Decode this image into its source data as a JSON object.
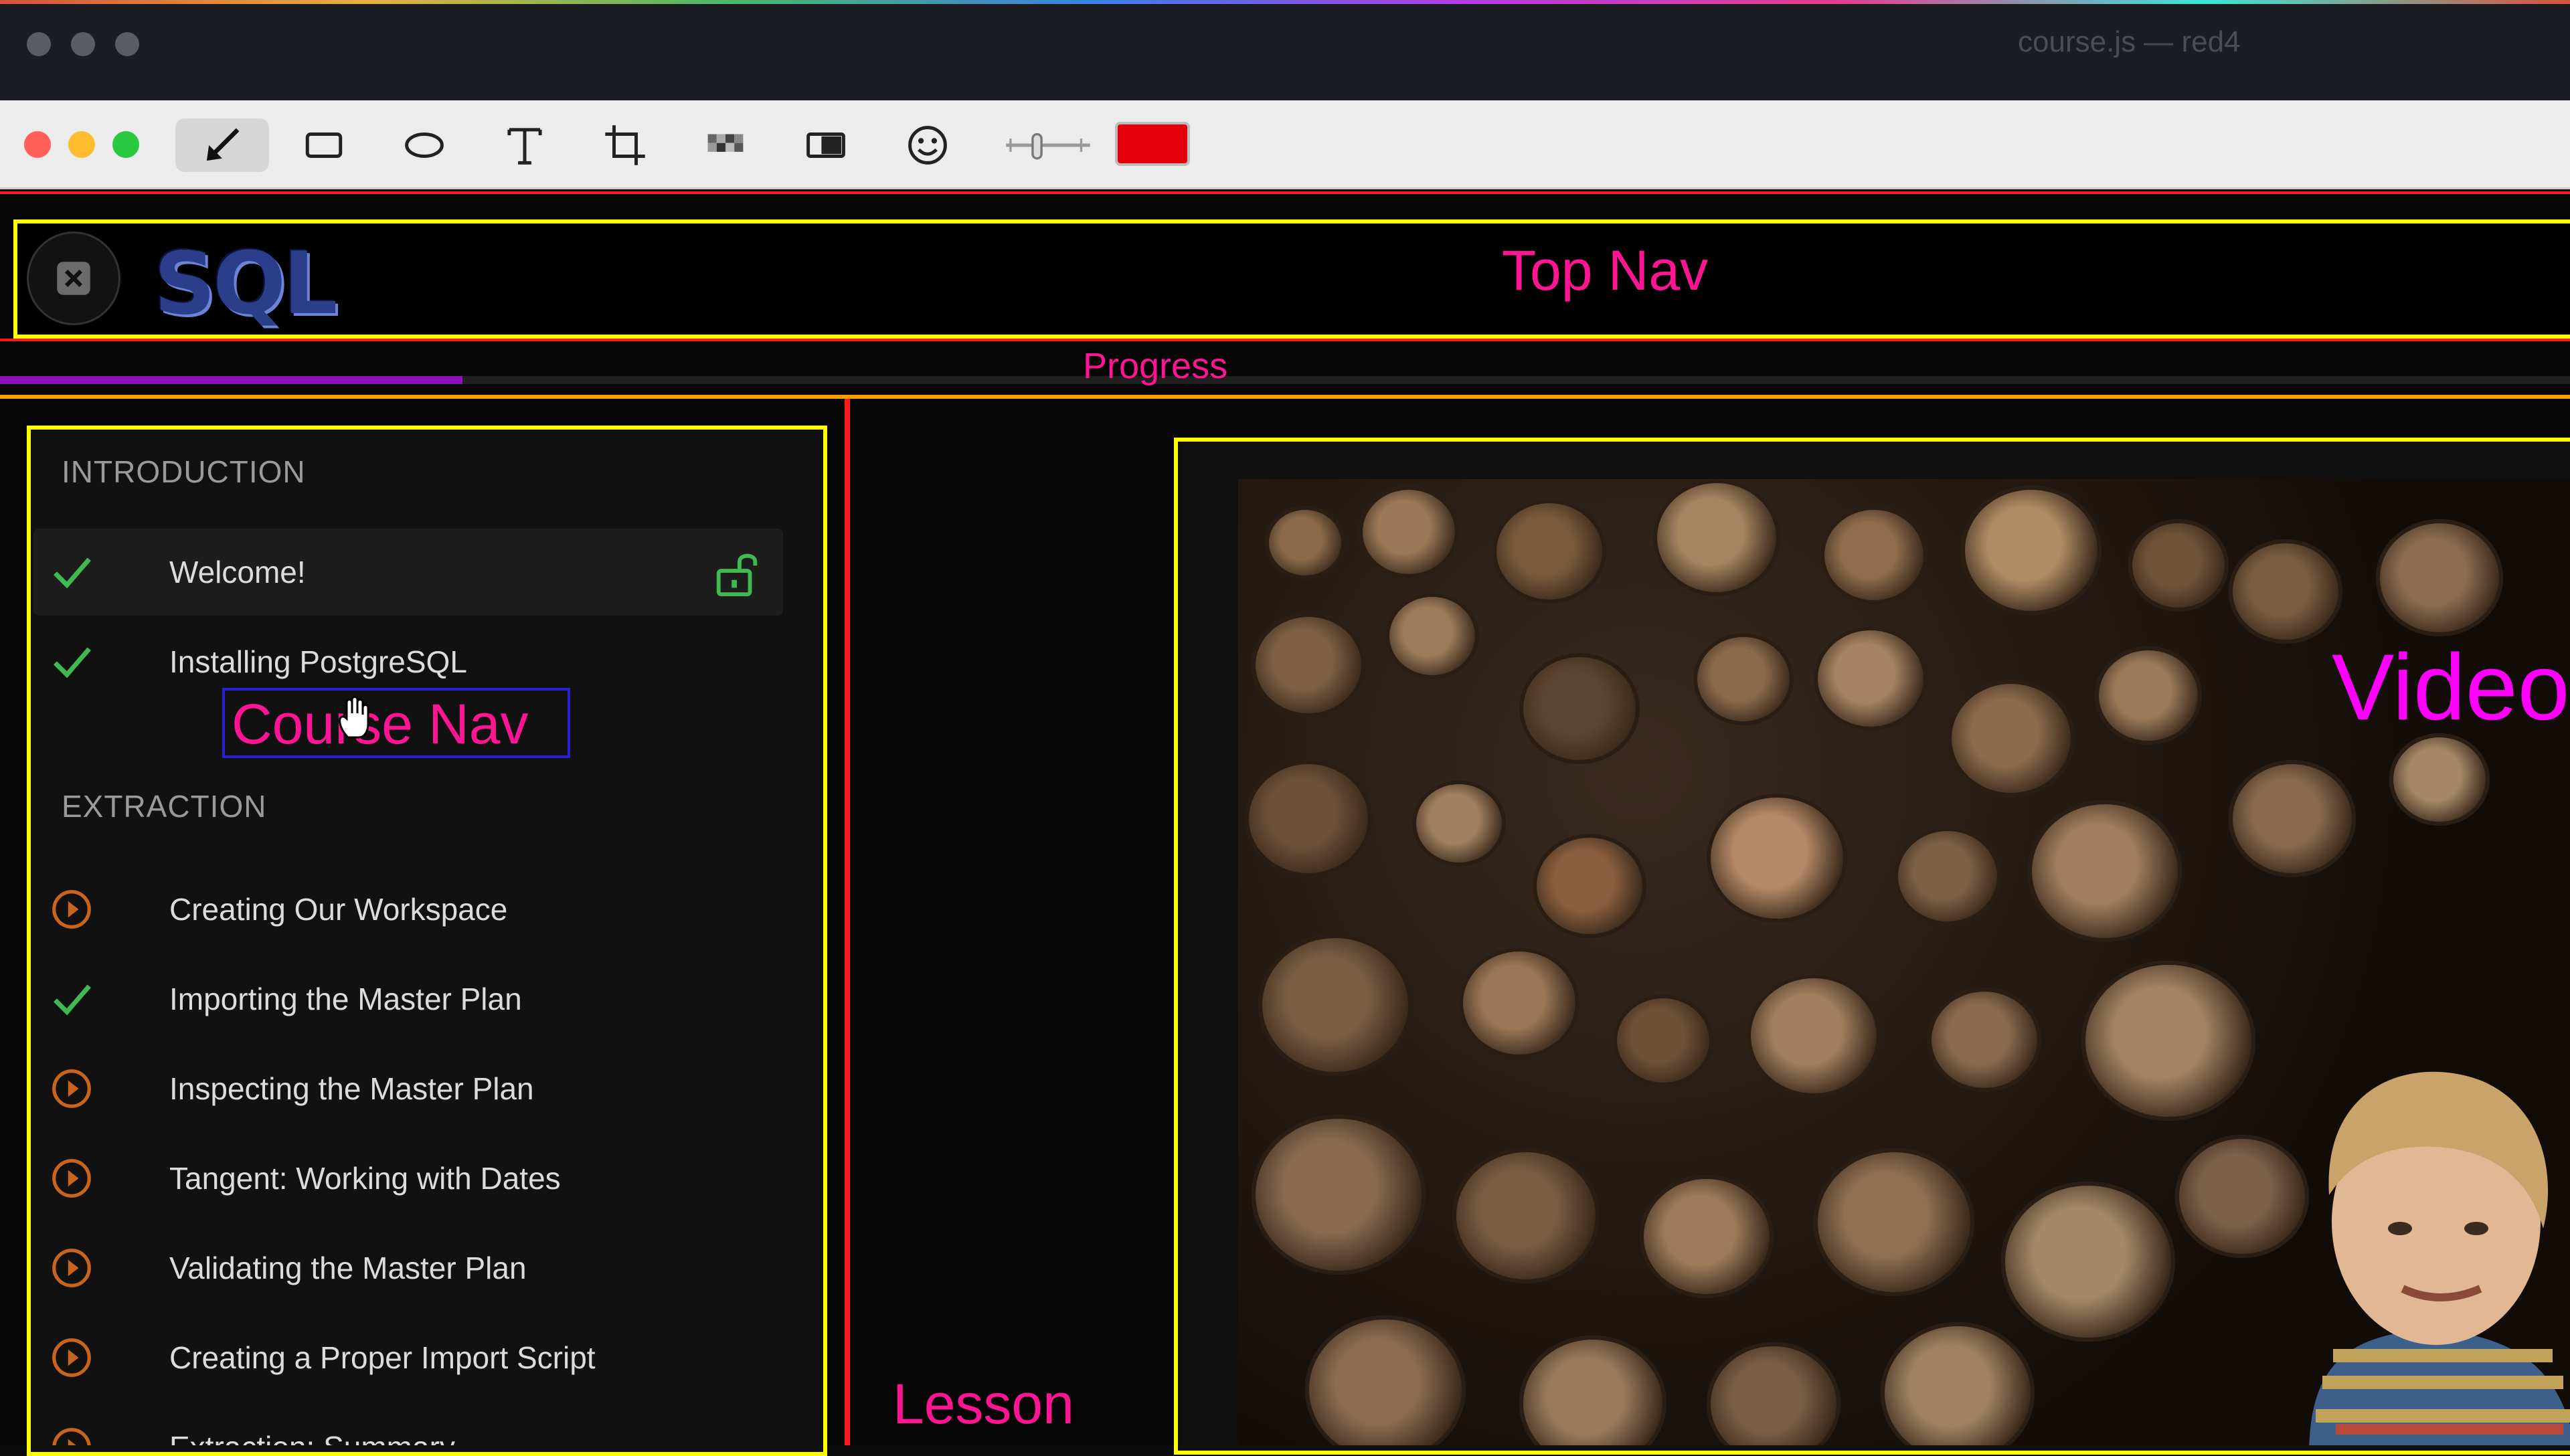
{
  "window": {
    "title": "course.js — red4"
  },
  "toolbar": {
    "tools": [
      "arrow-tool",
      "rectangle-tool",
      "ellipse-tool",
      "text-tool",
      "crop-tool",
      "pixelate-tool",
      "highlight-tool",
      "emoji-tool",
      "stroke-width-slider",
      "color-picker"
    ],
    "color": "#e3000b"
  },
  "annotations": {
    "top_nav": "Top Nav",
    "progress": "Progress",
    "course_nav": "Course Nav",
    "lesson": "Lesson",
    "video": "Video"
  },
  "header": {
    "logo": "SQL"
  },
  "progress": {
    "fraction": 0.18
  },
  "course": {
    "sections": [
      {
        "title": "INTRODUCTION"
      },
      {
        "title": "EXTRACTION"
      }
    ],
    "lessons": [
      {
        "title": "Welcome!",
        "status": "complete",
        "active": true,
        "unlocked": true
      },
      {
        "title": "Installing PostgreSQL",
        "status": "complete"
      },
      {
        "title": "Creating Our Workspace",
        "status": "play"
      },
      {
        "title": "Importing the Master Plan",
        "status": "complete"
      },
      {
        "title": "Inspecting the Master Plan",
        "status": "play"
      },
      {
        "title": "Tangent: Working with Dates",
        "status": "play"
      },
      {
        "title": "Validating the Master Plan",
        "status": "play"
      },
      {
        "title": "Creating a Proper Import Script",
        "status": "play"
      },
      {
        "title": "Extraction: Summary",
        "status": "play"
      }
    ]
  },
  "colors": {
    "annotation_text": "#ff1493",
    "annotation_video": "#ff00ff",
    "outline_yellow": "#ffff00",
    "outline_red": "#ff1a1a",
    "check_green": "#3fb950",
    "play_orange": "#c8641e",
    "progress_purple": "#8a12b8"
  }
}
